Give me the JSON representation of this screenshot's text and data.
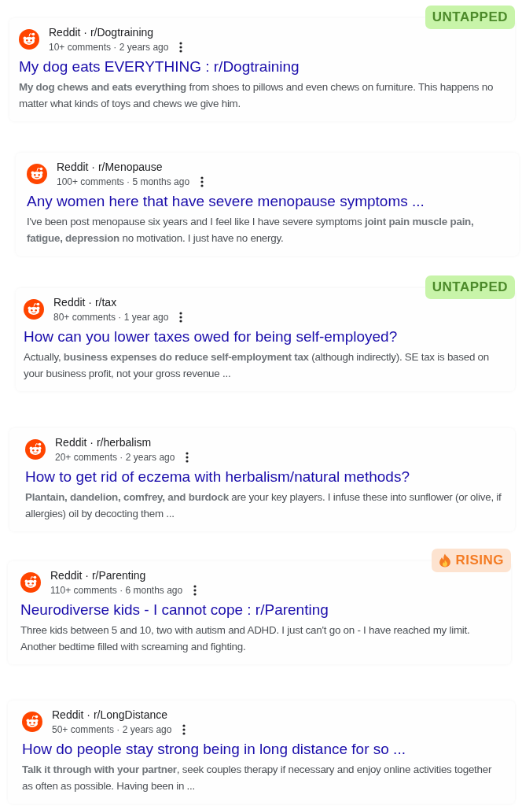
{
  "results": [
    {
      "badge": {
        "kind": "untapped",
        "label": "UNTAPPED"
      },
      "source": "Reddit · r/Dogtraining",
      "meta": "10+ comments · 2 years ago",
      "title": "My dog eats EVERYTHING : r/Dogtraining",
      "snippet": "**My dog chews and eats everything** from shoes to pillows and even chews on furniture. This happens no matter what kinds of toys and chews we give him."
    },
    {
      "source": "Reddit · r/Menopause",
      "meta": "100+ comments · 5 months ago",
      "title": "Any women here that have severe menopause symptoms ...",
      "snippet": "I've been post menopause six years and I feel like I have severe symptoms **joint pain muscle pain, fatigue, depression** no motivation. I just have no energy."
    },
    {
      "badge": {
        "kind": "untapped",
        "label": "UNTAPPED"
      },
      "source": "Reddit · r/tax",
      "meta": "80+ comments · 1 year ago",
      "title": "How can you lower taxes owed for being self-employed?",
      "snippet": "Actually, **business expenses do reduce self-employment tax** (although indirectly). SE tax is based on your business profit, not your gross revenue ..."
    },
    {
      "source": "Reddit · r/herbalism",
      "meta": "20+ comments · 2 years ago",
      "title": "How to get rid of eczema with herbalism/natural methods?",
      "snippet": "**Plantain, dandelion, comfrey, and burdock** are your key players. I infuse these into sunflower (or olive, if allergies) oil by decocting them ..."
    },
    {
      "badge": {
        "kind": "rising",
        "label": "RISING"
      },
      "source": "Reddit · r/Parenting",
      "meta": "110+ comments · 6 months ago",
      "title": "Neurodiverse kids - I cannot cope : r/Parenting",
      "snippet": "Three kids between 5 and 10, two with autism and ADHD. I just can't go on - I have reached my limit. Another bedtime filled with screaming and fighting."
    },
    {
      "source": "Reddit · r/LongDistance",
      "meta": "50+ comments · 2 years ago",
      "title": "How do people stay strong being in long distance for so ...",
      "snippet": "**Talk it through with your partner**, seek couples therapy if necessary and enjoy online activities together as often as possible. Having been in ..."
    }
  ]
}
